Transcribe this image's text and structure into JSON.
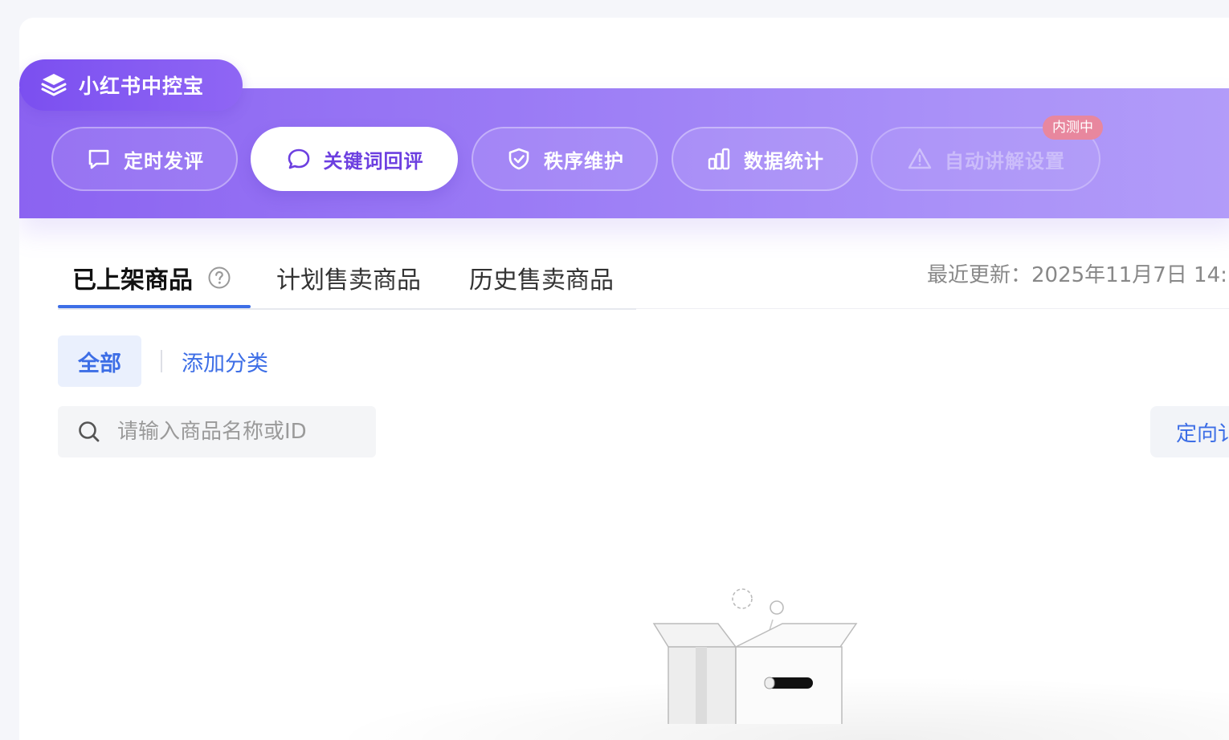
{
  "brand": {
    "title": "小红书中控宝",
    "icon": "layers-icon"
  },
  "nav": {
    "items": [
      {
        "label": "定时发评",
        "icon": "comment-square-icon",
        "state": "normal"
      },
      {
        "label": "关键词回评",
        "icon": "chat-bubble-icon",
        "state": "active"
      },
      {
        "label": "秩序维护",
        "icon": "shield-check-icon",
        "state": "normal"
      },
      {
        "label": "数据统计",
        "icon": "bar-chart-icon",
        "state": "normal"
      },
      {
        "label": "自动讲解设置",
        "icon": "warning-icon",
        "state": "disabled"
      }
    ],
    "beta_badge": "内测中"
  },
  "tabs": {
    "items": [
      {
        "label": "已上架商品",
        "active": true
      },
      {
        "label": "计划售卖商品",
        "active": false
      },
      {
        "label": "历史售卖商品",
        "active": false
      }
    ],
    "help_icon": "question-circle-icon"
  },
  "last_update": "最近更新：2025年11月7日 14:",
  "categories": {
    "all_label": "全部",
    "add_label": "添加分类"
  },
  "search": {
    "placeholder": "请输入商品名称或ID",
    "value": ""
  },
  "directed_button": {
    "label": "定向讠"
  },
  "colors": {
    "brand_purple": "#8b63f1",
    "accent_blue": "#3d6ee6",
    "beta_pink": "#e8879e"
  }
}
